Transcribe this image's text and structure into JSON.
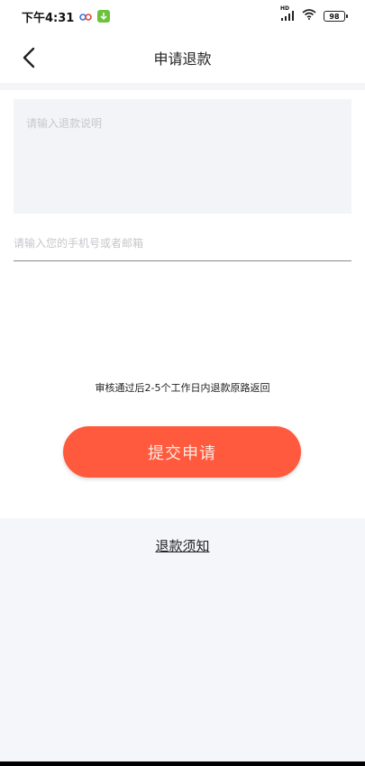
{
  "status_bar": {
    "time": "下午4:31",
    "network_label": "HD",
    "battery_level": "98"
  },
  "header": {
    "title": "申请退款"
  },
  "form": {
    "note_placeholder": "请输入退款说明",
    "contact_placeholder": "请输入您的手机号或者邮箱",
    "hint": "审核通过后2-5个工作日内退款原路返回",
    "submit_label": "提交申请"
  },
  "footer": {
    "policy_link": "退款须知"
  },
  "colors": {
    "accent": "#ff5a3d",
    "input_bg": "#f3f4f8",
    "section_bg": "#f5f6fa"
  }
}
